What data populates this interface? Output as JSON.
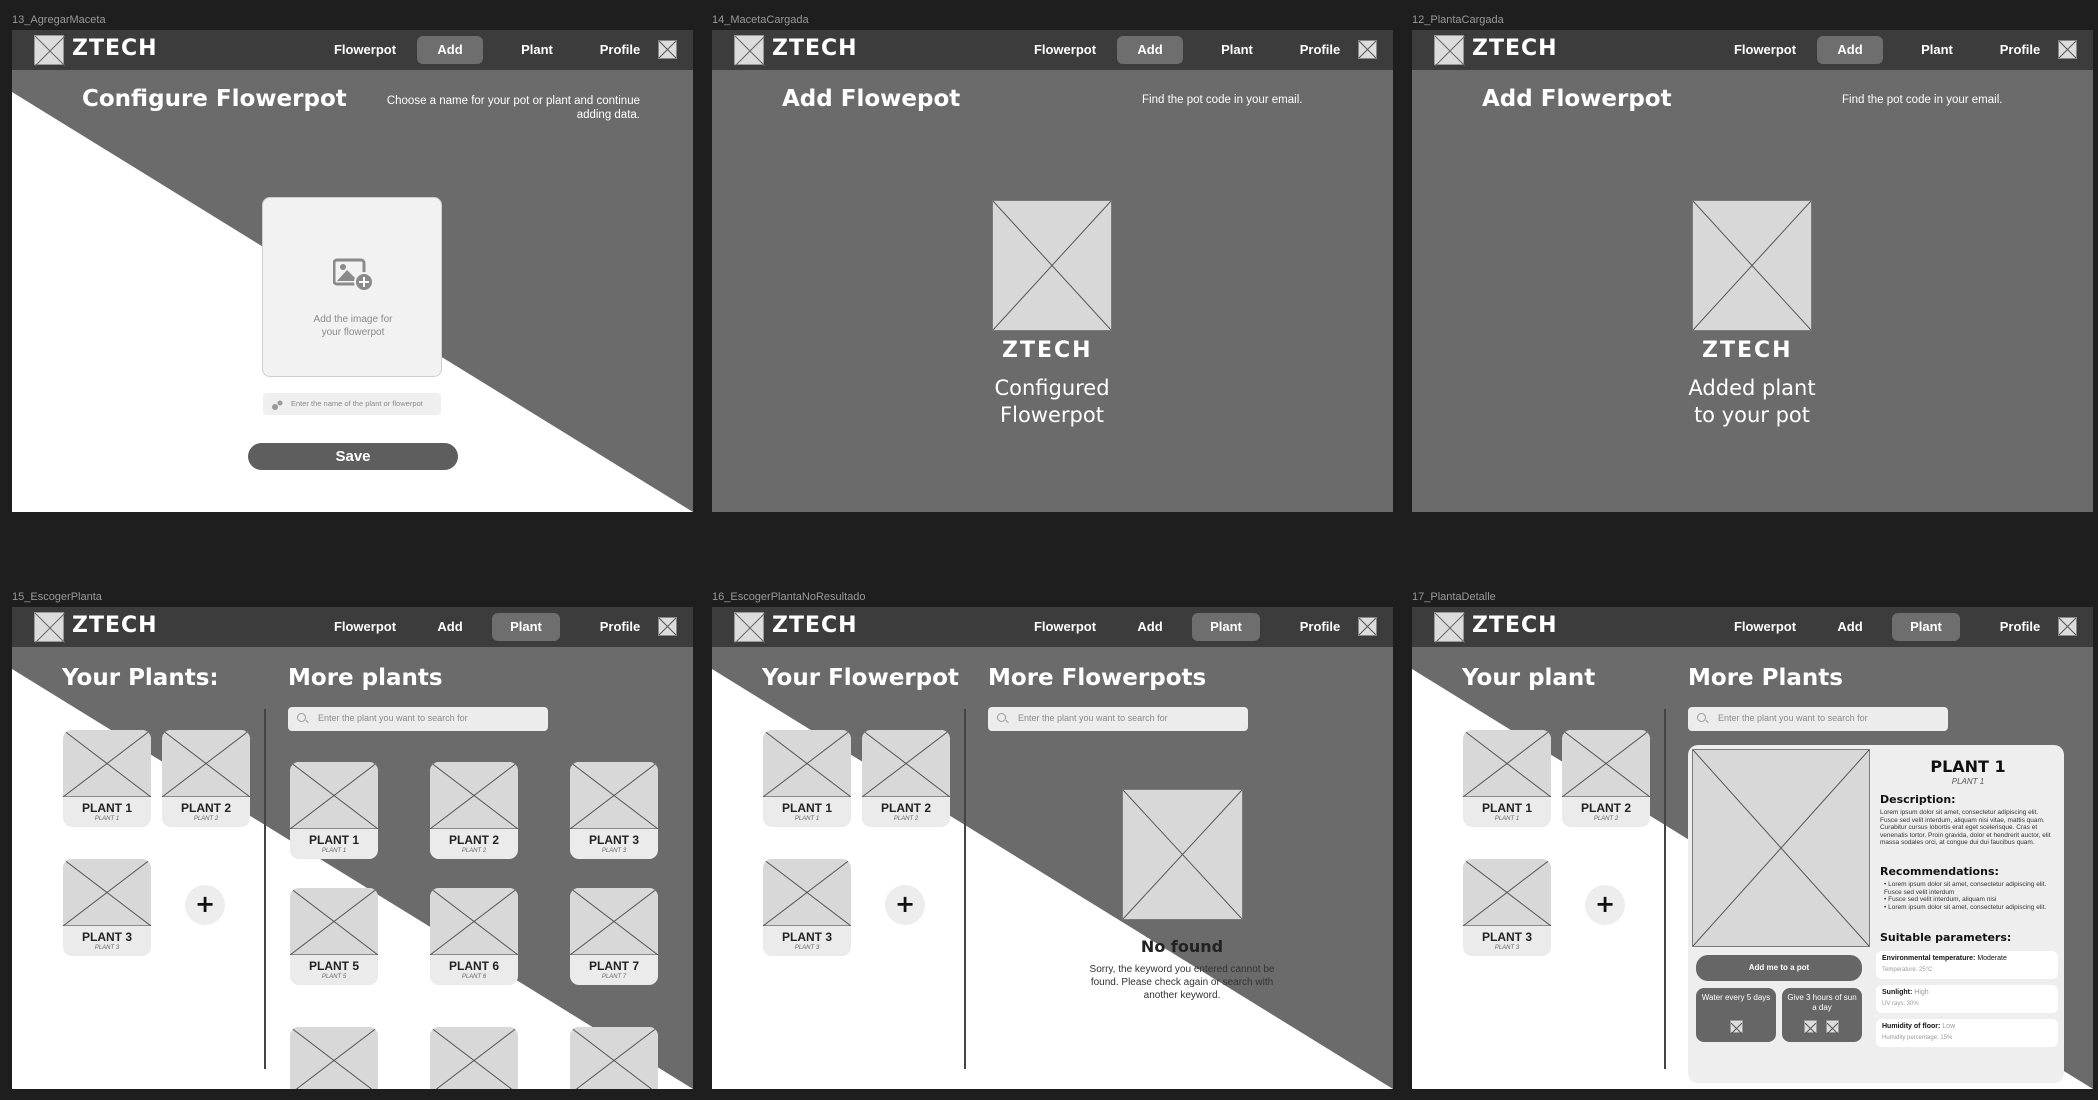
{
  "brand": "ZTECH",
  "nav": {
    "flowerpot": "Flowerpot",
    "add": "Add",
    "plant": "Plant",
    "profile": "Profile"
  },
  "frames": [
    {
      "label": "13_AgregarMaceta",
      "title": "Configure  Flowerpot",
      "subtitle": "Choose a name for your pot or plant and continue adding data.",
      "upload_text": "Add the image for your flowerpot",
      "name_placeholder": "Enter the name of the plant or flowerpot",
      "save_label": "Save"
    },
    {
      "label": "14_MacetaCargada",
      "title": "Add Flowepot",
      "subtitle": "Find the pot code in your email.",
      "brand": "ZTECH",
      "message_line1": "Configured",
      "message_line2": "Flowerpot"
    },
    {
      "label": "12_PlantaCargada",
      "title": "Add Flowerpot",
      "subtitle": "Find the pot code in your email.",
      "brand": "ZTECH",
      "message_line1": "Added plant",
      "message_line2": "to your pot"
    },
    {
      "label": "15_EscogerPlanta",
      "left_title": "Your Plants:",
      "right_title": "More plants",
      "search_placeholder": "Enter the plant you want to search for",
      "my_plants": [
        {
          "name": "PLANT 1",
          "sub": "PLANT 1"
        },
        {
          "name": "PLANT 2",
          "sub": "PLANT 2"
        },
        {
          "name": "PLANT 3",
          "sub": "PLANT 3"
        }
      ],
      "more_plants": [
        {
          "name": "PLANT 1",
          "sub": "PLANT 1"
        },
        {
          "name": "PLANT 2",
          "sub": "PLANT 2"
        },
        {
          "name": "PLANT 3",
          "sub": "PLANT 3"
        },
        {
          "name": "PLANT 5",
          "sub": "PLANT 5"
        },
        {
          "name": "PLANT 6",
          "sub": "PLANT 6"
        },
        {
          "name": "PLANT 7",
          "sub": "PLANT 7"
        }
      ],
      "add_glyph": "+"
    },
    {
      "label": "16_EscogerPlantaNoResultado",
      "left_title": "Your Flowerpot",
      "right_title": "More Flowerpots",
      "search_placeholder": "Enter the plant you want to search for",
      "my_plants": [
        {
          "name": "PLANT 1",
          "sub": "PLANT 1"
        },
        {
          "name": "PLANT 2",
          "sub": "PLANT 2"
        },
        {
          "name": "PLANT 3",
          "sub": "PLANT 3"
        }
      ],
      "add_glyph": "+",
      "not_found_title": "No found",
      "not_found_text": "Sorry, the keyword you entered cannot be found. Please check again or search with another keyword."
    },
    {
      "label": "17_PlantaDetalle",
      "left_title": "Your plant",
      "right_title": "More Plants",
      "search_placeholder": "Enter the plant you want to search for",
      "my_plants": [
        {
          "name": "PLANT 1",
          "sub": "PLANT 1"
        },
        {
          "name": "PLANT 2",
          "sub": "PLANT 2"
        },
        {
          "name": "PLANT 3",
          "sub": "PLANT 3"
        }
      ],
      "add_glyph": "+",
      "detail": {
        "name": "PLANT 1",
        "sub": "PLANT 1",
        "description_label": "Description:",
        "description": "Lorem ipsum dolor sit amet, consectetur adipiscing elit. Fusce sed velit interdum, aliquam nisi vitae, mattis quam. Curabitur cursus lobortis erat eget scelerisque. Cras et venenatis tortor. Proin gravida, dolor et hendrerit auctor, elit massa sodales orci, at congue dui dui faucibus quam.",
        "recommendations_label": "Recommendations:",
        "recommendations": [
          "Lorem ipsum dolor sit amet, consectetur adipiscing elit. Fusce sed velit interdum",
          "Fusce sed velit interdum, aliquam nisi",
          "Lorem ipsum dolor sit amet, consectetur adipiscing elit."
        ],
        "params_label": "Suitable parameters:",
        "params": [
          {
            "label": "Environmental temperature:",
            "value": "Moderate",
            "detail": "Temperature: 25°C"
          },
          {
            "label": "Sunlight:",
            "value": "High",
            "detail": "UV rays: 30%"
          },
          {
            "label": "Humidity of floor:",
            "value": "Low",
            "detail": "Humidity percentage: 15%"
          }
        ],
        "add_button": "Add me to a pot",
        "care": [
          {
            "text": "Water every 5 days"
          },
          {
            "text": "Give 3 hours of sun a day"
          }
        ]
      }
    }
  ]
}
